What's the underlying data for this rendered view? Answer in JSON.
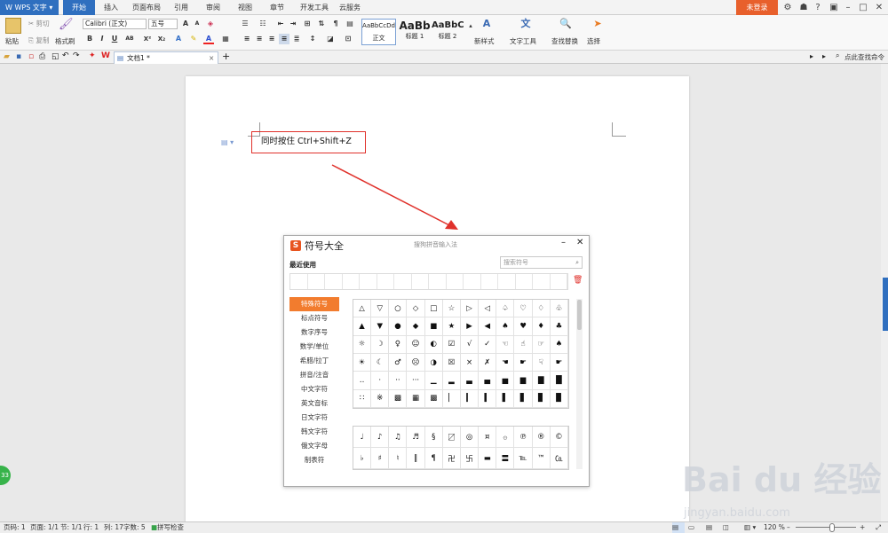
{
  "app": {
    "name": "WPS 文字",
    "login": "未登录"
  },
  "tabs": [
    "开始",
    "插入",
    "页面布局",
    "引用",
    "审阅",
    "视图",
    "章节",
    "开发工具",
    "云服务"
  ],
  "ribbon": {
    "paste": "粘贴",
    "cut": "剪切",
    "copy": "复制",
    "format_painter": "格式刷",
    "font_name": "Calibri (正文)",
    "font_size": "五号",
    "styles": [
      {
        "preview": "AaBbCcDd",
        "name": "正文"
      },
      {
        "preview": "AaBb",
        "name": "标题 1"
      },
      {
        "preview": "AaBbC",
        "name": "标题 2"
      }
    ],
    "new_style": "新样式",
    "text_tools": "文字工具",
    "find_replace": "查找替换",
    "select": "选择"
  },
  "doc_tab": "文档1 *",
  "right_quick": "点此查找命令",
  "document": {
    "text": "同时按住 Ctrl+Shift+Z"
  },
  "dialog": {
    "title": "符号大全",
    "subtitle": "搜狗拼音输入法",
    "recent": "最近使用",
    "search_placeholder": "搜索符号",
    "categories": [
      "特殊符号",
      "标点符号",
      "数字序号",
      "数学/单位",
      "希腊/拉丁",
      "拼音/注音",
      "中文字符",
      "英文音标",
      "日文字符",
      "韩文字符",
      "俄文字母",
      "制表符"
    ],
    "grid1": [
      "△",
      "▽",
      "○",
      "◇",
      "□",
      "☆",
      "▷",
      "◁",
      "♤",
      "♡",
      "♢",
      "♧",
      "▲",
      "▼",
      "●",
      "◆",
      "■",
      "★",
      "▶",
      "◀",
      "♠",
      "♥",
      "♦",
      "♣",
      "☼",
      "☽",
      "♀",
      "☺",
      "◐",
      "☑",
      "√",
      "✓",
      "☜",
      "☝",
      "☞",
      "♠",
      "☀",
      "☾",
      "♂",
      "☹",
      "◑",
      "☒",
      "×",
      "✗",
      "☚",
      "☛",
      "☟",
      "☛",
      "‥",
      "·",
      "··",
      "···",
      "▁",
      "▂",
      "▃",
      "▄",
      "▅",
      "▆",
      "▇",
      "█",
      "∷",
      "※",
      "▩",
      "▦",
      "▩",
      "▏",
      "▎",
      "▍",
      "▌",
      "▋",
      "▊",
      "▉"
    ],
    "grid2": [
      "♩",
      "♪",
      "♫",
      "♬",
      "§",
      "〼",
      "◎",
      "¤",
      "۞",
      "℗",
      "®",
      "©",
      "♭",
      "♯",
      "♮",
      "‖",
      "¶",
      "卍",
      "卐",
      "▬",
      "〓",
      "℡",
      "™",
      "㏇"
    ]
  },
  "status": {
    "page": "页码: 1",
    "pages": "页面: 1/1",
    "section": "节: 1/1",
    "row": "行: 1",
    "col": "列: 17",
    "words": "字数: 5",
    "spell": "拼写检查",
    "zoom": "120 %"
  },
  "watermark": {
    "brand": "Bai du 经验",
    "url": "jingyan.baidu.com"
  },
  "colors": {
    "accent": "#2f6fbf",
    "login": "#e8602c",
    "annotation": "#e0312b",
    "category_selected": "#f27c2e"
  }
}
